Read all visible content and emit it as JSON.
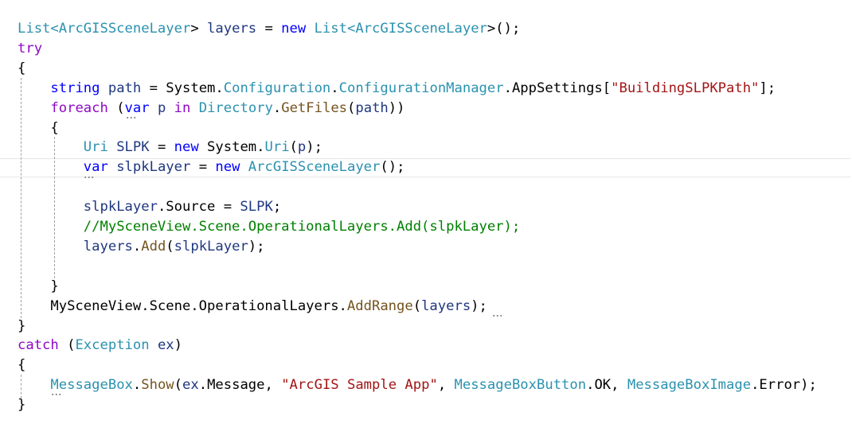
{
  "editor": {
    "lines": [
      [
        {
          "t": "List<",
          "c": "type"
        },
        {
          "t": "ArcGISSceneLayer",
          "c": "type"
        },
        {
          "t": "> ",
          "c": "default"
        },
        {
          "t": "layers",
          "c": "ident"
        },
        {
          "t": " = ",
          "c": "default"
        },
        {
          "t": "new",
          "c": "keyword"
        },
        {
          "t": " ",
          "c": "default"
        },
        {
          "t": "List<",
          "c": "type"
        },
        {
          "t": "ArcGISSceneLayer",
          "c": "type"
        },
        {
          "t": ">();",
          "c": "default"
        }
      ],
      [
        {
          "t": "try",
          "c": "control"
        }
      ],
      [
        {
          "t": "{",
          "c": "default"
        }
      ],
      [
        {
          "t": "    ",
          "c": "default"
        },
        {
          "t": "string",
          "c": "keyword"
        },
        {
          "t": " ",
          "c": "default"
        },
        {
          "t": "path",
          "c": "ident"
        },
        {
          "t": " = System.",
          "c": "default"
        },
        {
          "t": "Configuration",
          "c": "type"
        },
        {
          "t": ".",
          "c": "default"
        },
        {
          "t": "ConfigurationManager",
          "c": "type"
        },
        {
          "t": ".AppSettings[",
          "c": "default"
        },
        {
          "t": "\"BuildingSLPKPath\"",
          "c": "string"
        },
        {
          "t": "];",
          "c": "default"
        }
      ],
      [
        {
          "t": "    ",
          "c": "default"
        },
        {
          "t": "foreach",
          "c": "control"
        },
        {
          "t": " (",
          "c": "default"
        },
        {
          "t": "var",
          "c": "keyword"
        },
        {
          "t": " ",
          "c": "default"
        },
        {
          "t": "p",
          "c": "ident"
        },
        {
          "t": " ",
          "c": "default"
        },
        {
          "t": "in",
          "c": "control"
        },
        {
          "t": " ",
          "c": "default"
        },
        {
          "t": "Directory",
          "c": "type"
        },
        {
          "t": ".",
          "c": "default"
        },
        {
          "t": "GetFiles",
          "c": "method"
        },
        {
          "t": "(",
          "c": "default"
        },
        {
          "t": "path",
          "c": "ident"
        },
        {
          "t": "))",
          "c": "default"
        }
      ],
      [
        {
          "t": "    {",
          "c": "default"
        }
      ],
      [
        {
          "t": "        ",
          "c": "default"
        },
        {
          "t": "Uri",
          "c": "type"
        },
        {
          "t": " ",
          "c": "default"
        },
        {
          "t": "SLPK",
          "c": "ident"
        },
        {
          "t": " = ",
          "c": "default"
        },
        {
          "t": "new",
          "c": "keyword"
        },
        {
          "t": " System.",
          "c": "default"
        },
        {
          "t": "Uri",
          "c": "type"
        },
        {
          "t": "(",
          "c": "default"
        },
        {
          "t": "p",
          "c": "ident"
        },
        {
          "t": ");",
          "c": "default"
        }
      ],
      [
        {
          "t": "        ",
          "c": "default"
        },
        {
          "t": "var",
          "c": "keyword"
        },
        {
          "t": " ",
          "c": "default"
        },
        {
          "t": "slpkLayer",
          "c": "ident"
        },
        {
          "t": " = ",
          "c": "default"
        },
        {
          "t": "new",
          "c": "keyword"
        },
        {
          "t": " ",
          "c": "default"
        },
        {
          "t": "ArcGISSceneLayer",
          "c": "type"
        },
        {
          "t": "();",
          "c": "default"
        }
      ],
      [],
      [
        {
          "t": "        ",
          "c": "default"
        },
        {
          "t": "slpkLayer",
          "c": "ident"
        },
        {
          "t": ".Source = ",
          "c": "default"
        },
        {
          "t": "SLPK",
          "c": "ident"
        },
        {
          "t": ";",
          "c": "default"
        }
      ],
      [
        {
          "t": "        ",
          "c": "default"
        },
        {
          "t": "//MySceneView.Scene.OperationalLayers.Add(slpkLayer);",
          "c": "comment"
        }
      ],
      [
        {
          "t": "        ",
          "c": "default"
        },
        {
          "t": "layers",
          "c": "ident"
        },
        {
          "t": ".",
          "c": "default"
        },
        {
          "t": "Add",
          "c": "method"
        },
        {
          "t": "(",
          "c": "default"
        },
        {
          "t": "slpkLayer",
          "c": "ident"
        },
        {
          "t": ");",
          "c": "default"
        }
      ],
      [],
      [
        {
          "t": "    }",
          "c": "default"
        }
      ],
      [
        {
          "t": "    MySceneView.Scene.OperationalLayers.",
          "c": "default"
        },
        {
          "t": "AddRange",
          "c": "method"
        },
        {
          "t": "(",
          "c": "default"
        },
        {
          "t": "layers",
          "c": "ident"
        },
        {
          "t": ");",
          "c": "default"
        }
      ],
      [
        {
          "t": "}",
          "c": "default"
        }
      ],
      [
        {
          "t": "catch",
          "c": "control"
        },
        {
          "t": " (",
          "c": "default"
        },
        {
          "t": "Exception",
          "c": "type"
        },
        {
          "t": " ",
          "c": "default"
        },
        {
          "t": "ex",
          "c": "ident"
        },
        {
          "t": ")",
          "c": "default"
        }
      ],
      [
        {
          "t": "{",
          "c": "default"
        }
      ],
      [
        {
          "t": "    ",
          "c": "default"
        },
        {
          "t": "MessageBox",
          "c": "type"
        },
        {
          "t": ".",
          "c": "default"
        },
        {
          "t": "Show",
          "c": "method"
        },
        {
          "t": "(",
          "c": "default"
        },
        {
          "t": "ex",
          "c": "ident"
        },
        {
          "t": ".Message, ",
          "c": "default"
        },
        {
          "t": "\"ArcGIS Sample App\"",
          "c": "string"
        },
        {
          "t": ", ",
          "c": "default"
        },
        {
          "t": "MessageBoxButton",
          "c": "type"
        },
        {
          "t": ".OK, ",
          "c": "default"
        },
        {
          "t": "MessageBoxImage",
          "c": "type"
        },
        {
          "t": ".Error);",
          "c": "default"
        }
      ],
      [
        {
          "t": "}",
          "c": "default"
        }
      ]
    ]
  }
}
